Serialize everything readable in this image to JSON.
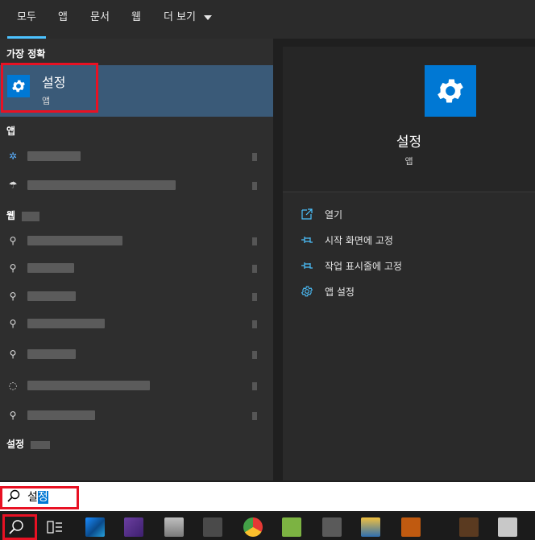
{
  "tabs": [
    {
      "label": "모두",
      "active": true
    },
    {
      "label": "앱"
    },
    {
      "label": "문서"
    },
    {
      "label": "웹"
    },
    {
      "label": "더 보기"
    }
  ],
  "left": {
    "best_header": "가장 정확",
    "best_match": {
      "title": "설정",
      "subtitle": "앱"
    },
    "apps_header": "앱",
    "web_header": "웹",
    "settings_header": "설정"
  },
  "right": {
    "title": "설정",
    "subtitle": "앱",
    "actions": [
      {
        "label": "열기"
      },
      {
        "label": "시작 화면에 고정"
      },
      {
        "label": "작업 표시줄에 고정"
      },
      {
        "label": "앱 설정"
      }
    ]
  },
  "search": {
    "typed": "설",
    "selected": "정"
  },
  "colors": {
    "accent": "#0078d4",
    "selection": "#3a5a78",
    "highlight": "#e81123",
    "tab_indicator": "#4cc2ff"
  }
}
